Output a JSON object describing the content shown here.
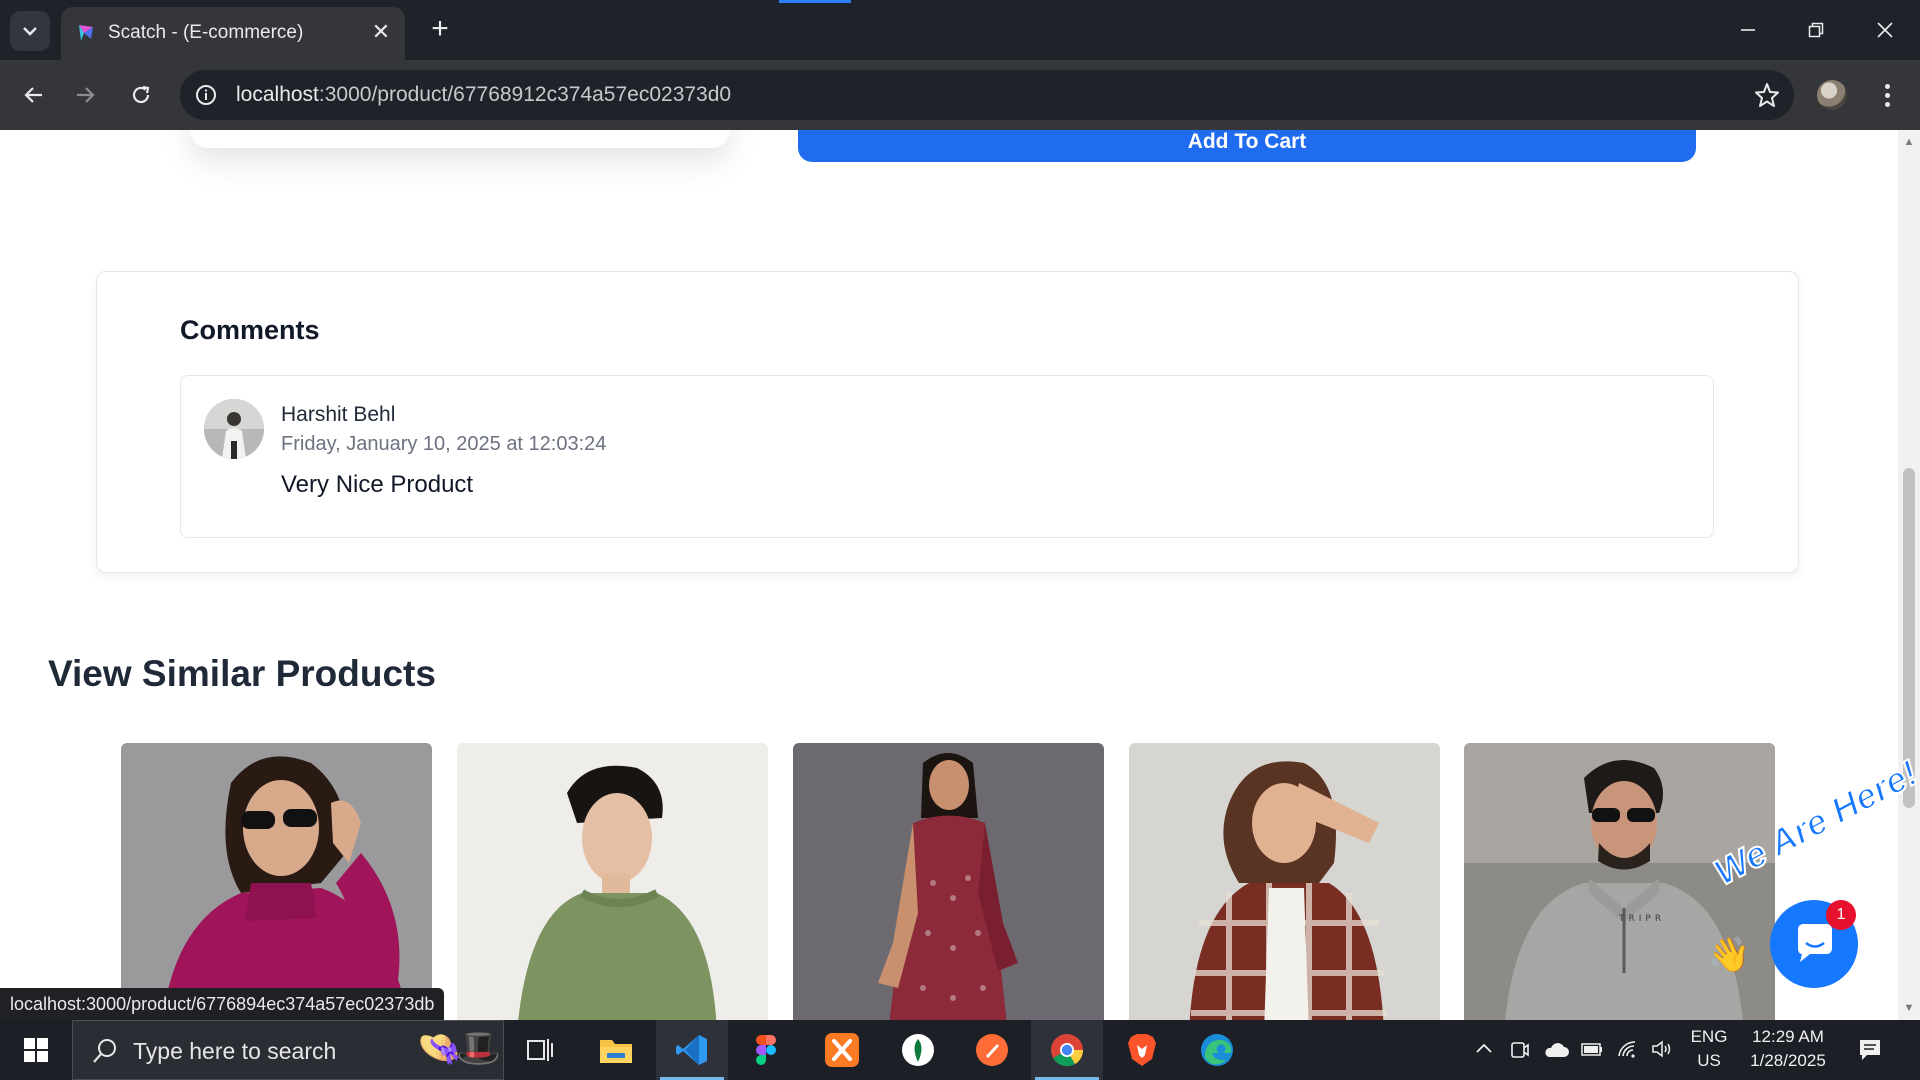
{
  "browser": {
    "tab_title": "Scatch - (E-commerce)",
    "url_host": "localhost",
    "url_path": ":3000/product/67768912c374a57ec02373d0",
    "status_url": "localhost:3000/product/6776894ec374a57ec02373db"
  },
  "product": {
    "add_to_cart_label": "Add To Cart"
  },
  "comments": {
    "heading": "Comments",
    "items": [
      {
        "author": "Harshit Behl",
        "date": "Friday, January 10, 2025 at 12:03:24",
        "text": "Very Nice Product"
      }
    ]
  },
  "similar": {
    "heading": "View Similar Products",
    "products": [
      {
        "image": "woman-magenta-sweater-sunglasses"
      },
      {
        "image": "man-green-sweatshirt"
      },
      {
        "image": "woman-maroon-kurta-set"
      },
      {
        "image": "woman-plaid-shacket"
      },
      {
        "image": "man-grey-half-zip-sweatshirt",
        "print": "TRIPR"
      }
    ]
  },
  "chat": {
    "banner": "We Are Here!",
    "badge_count": "1"
  },
  "taskbar": {
    "search_placeholder": "Type here to search",
    "language_line1": "ENG",
    "language_line2": "US",
    "time": "12:29 AM",
    "date": "1/28/2025"
  },
  "colors": {
    "accent_blue": "#1f6cf1",
    "chrome_dark": "#1f2229",
    "chrome_toolbar": "#35363a"
  }
}
